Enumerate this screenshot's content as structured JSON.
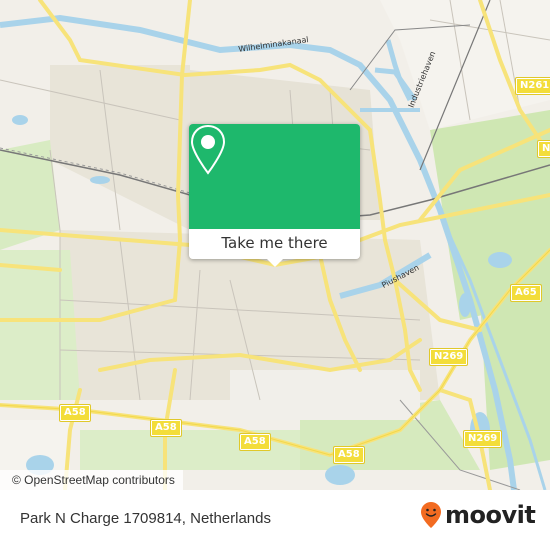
{
  "map": {
    "popup": {
      "button_label": "Take me there",
      "icon": "map-pin-icon",
      "color": "#1eb86c"
    },
    "road_labels": [
      {
        "id": "n261",
        "text": "N261"
      },
      {
        "id": "n-right",
        "text": "N"
      },
      {
        "id": "a65",
        "text": "A65"
      },
      {
        "id": "n269-a",
        "text": "N269"
      },
      {
        "id": "n269-b",
        "text": "N269"
      },
      {
        "id": "a58-a",
        "text": "A58"
      },
      {
        "id": "a58-b",
        "text": "A58"
      },
      {
        "id": "a58-c",
        "text": "A58"
      },
      {
        "id": "a58-d",
        "text": "A58"
      }
    ],
    "water_labels": [
      {
        "id": "wilhelminakanaal",
        "text": "Wilhelminakanaal"
      },
      {
        "id": "industriehaven",
        "text": "Industriehaven"
      },
      {
        "id": "piushaven",
        "text": "Piushaven"
      }
    ],
    "attribution": "© OpenStreetMap contributors"
  },
  "footer": {
    "place_title": "Park N Charge 1709814, Netherlands",
    "brand": "moovit",
    "brand_color": "#f26b21"
  }
}
